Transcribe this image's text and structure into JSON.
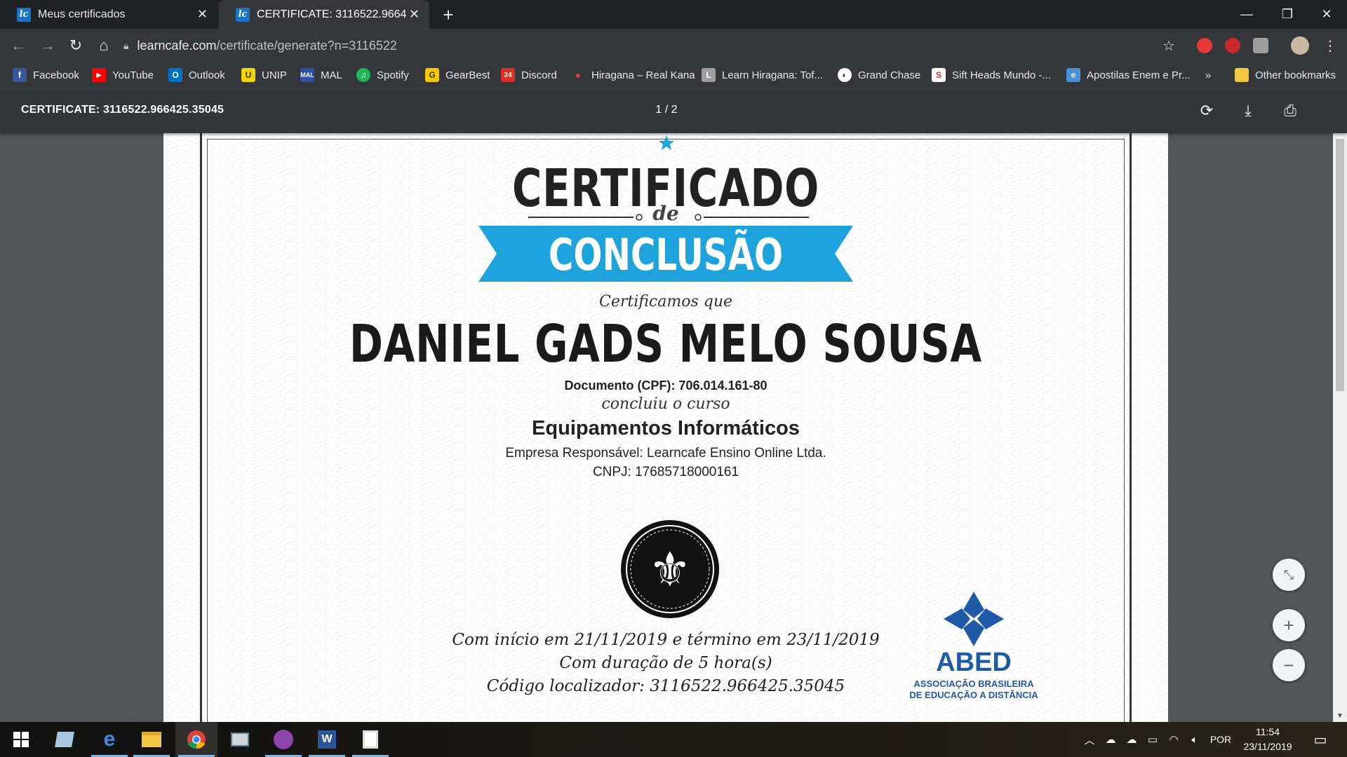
{
  "browser": {
    "tabs": [
      {
        "title": "Meus certificados",
        "active": false
      },
      {
        "title": "CERTIFICATE: 3116522.966425.35045",
        "active": true
      }
    ],
    "url": {
      "host": "learncafe.com",
      "path": "/certificate/generate?n=3116522"
    },
    "bookmarks": [
      {
        "label": "Facebook",
        "color": "#3b5998",
        "glyph": "f"
      },
      {
        "label": "YouTube",
        "color": "#ff0000",
        "glyph": "▶"
      },
      {
        "label": "Outlook",
        "color": "#0072c6",
        "glyph": "O"
      },
      {
        "label": "UNIP",
        "color": "#f5d400",
        "glyph": "U"
      },
      {
        "label": "MAL",
        "color": "#2e51a2",
        "glyph": "M"
      },
      {
        "label": "Spotify",
        "color": "#1db954",
        "glyph": "♫"
      },
      {
        "label": "GearBest",
        "color": "#f9c900",
        "glyph": "G"
      },
      {
        "label": "Discord",
        "color": "#d93025",
        "glyph": "24"
      },
      {
        "label": "Hiragana – Real Kana",
        "color": "#e53935",
        "glyph": "●"
      },
      {
        "label": "Learn Hiragana: Tof...",
        "color": "#9e9e9e",
        "glyph": "L"
      },
      {
        "label": "Grand Chase",
        "color": "#ffffff",
        "glyph": "◐"
      },
      {
        "label": "Sift Heads Mundo -...",
        "color": "#d32f2f",
        "glyph": "S"
      },
      {
        "label": "Apostilas Enem e Pr...",
        "color": "#4a90d9",
        "glyph": "e"
      }
    ],
    "more_bookmarks": "»",
    "other_bookmarks": "Other bookmarks"
  },
  "pdf": {
    "title": "CERTIFICATE: 3116522.966425.35045",
    "page_indicator": "1 / 2"
  },
  "certificate": {
    "heading": "CERTIFICADO",
    "de": "de",
    "ribbon": "CONCLUSÃO",
    "certificamos": "Certificamos que",
    "name": "DANIEL GADS MELO SOUSA",
    "cpf": "Documento (CPF): 706.014.161-80",
    "concluiu": "concluiu o curso",
    "course": "Equipamentos Informáticos",
    "empresa": "Empresa Responsável: Learncafe Ensino Online Ltda.",
    "cnpj": "CNPJ: 17685718000161",
    "dates": "Com início em 21/11/2019 e término em 23/11/2019",
    "duracao": "Com duração de 5 hora(s)",
    "codigo": "Código localizador: 3116522.966425.35045",
    "abed": {
      "name": "ABED",
      "sub1": "ASSOCIAÇÃO BRASILEIRA",
      "sub2": "DE EDUCAÇÃO A DISTÂNCIA"
    },
    "colors": {
      "ribbon": "#1fa3dc",
      "abed": "#1f5aa8"
    }
  },
  "taskbar": {
    "language": "POR",
    "time": "11:54",
    "date": "23/11/2019"
  }
}
